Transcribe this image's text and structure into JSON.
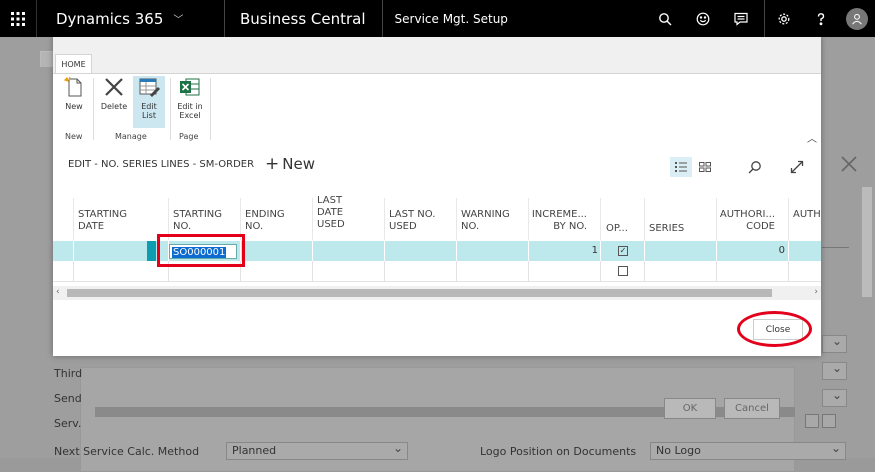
{
  "topbar": {
    "brand": "Dynamics 365",
    "app": "Business Central",
    "page": "Service Mgt. Setup"
  },
  "background": {
    "rows": [
      {
        "label": "Third"
      },
      {
        "label": "Send"
      },
      {
        "label": "Serv."
      },
      {
        "label": "Next Service Calc. Method",
        "value": "Planned"
      }
    ],
    "logo_label": "Logo Position on Documents",
    "logo_value": "No Logo",
    "ok_label": "OK",
    "cancel_label": "Cancel"
  },
  "ribbon": {
    "tab": "HOME",
    "buttons": {
      "new": "New",
      "delete": "Delete",
      "edit_list_1": "Edit",
      "edit_list_2": "List",
      "excel_1": "Edit in",
      "excel_2": "Excel"
    },
    "groups": {
      "new": "New",
      "manage": "Manage",
      "page": "Page"
    }
  },
  "header": {
    "title": "EDIT - NO. SERIES LINES - SM-ORDER",
    "new_label": "New"
  },
  "grid": {
    "columns": [
      {
        "l1": "STARTING",
        "l2": "DATE",
        "l3": ""
      },
      {
        "l1": "STARTING",
        "l2": "NO.",
        "l3": ""
      },
      {
        "l1": "ENDING",
        "l2": "NO.",
        "l3": ""
      },
      {
        "l1": "LAST",
        "l2": "DATE",
        "l3": "USED"
      },
      {
        "l1": "LAST NO.",
        "l2": "USED",
        "l3": ""
      },
      {
        "l1": "WARNING",
        "l2": "NO.",
        "l3": ""
      },
      {
        "l1": "INCREME...",
        "l2": "BY NO.",
        "l3": ""
      },
      {
        "l1": "OP...",
        "l2": "",
        "l3": ""
      },
      {
        "l1": "SERIES",
        "l2": "",
        "l3": ""
      },
      {
        "l1": "AUTHORI...",
        "l2": "CODE",
        "l3": ""
      },
      {
        "l1": "AUTH",
        "l2": "",
        "l3": ""
      }
    ],
    "rows": [
      {
        "starting_no": "SO000001",
        "increment": "1",
        "open_checked": true,
        "auth_code": "0"
      },
      {
        "starting_no": "",
        "increment": "",
        "open_checked": false,
        "auth_code": ""
      }
    ]
  },
  "close_label": "Close",
  "colors": {
    "topbar": "#000000",
    "row_selected": "#bde8ec",
    "row_marker": "#0e9cb0",
    "highlight_red": "#e2001a",
    "selection_blue": "#0c6bd0"
  }
}
